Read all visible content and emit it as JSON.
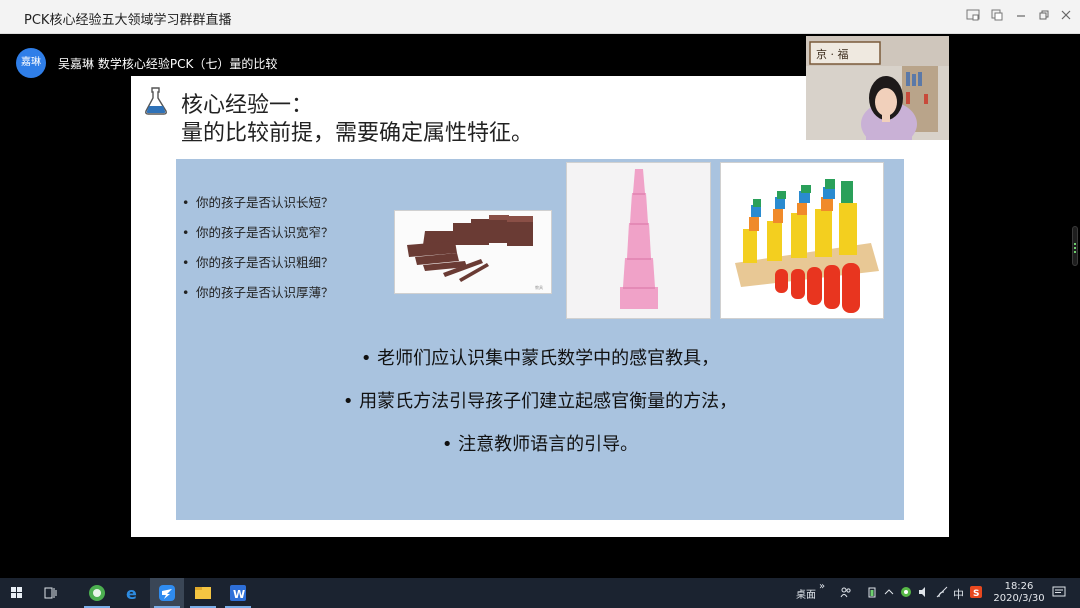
{
  "window": {
    "title": "PCK核心经验五大领域学习群群直播"
  },
  "presenter": {
    "avatar_text": "嘉琳",
    "name": "吴嘉琳",
    "topic": "数学核心经验PCK（七）量的比较"
  },
  "slide": {
    "heading_line1": "核心经验一：",
    "heading_line2": "量的比较前提，需要确定属性特征。",
    "questions": [
      "你的孩子是否认识长短？",
      "你的孩子是否认识宽窄？",
      "你的孩子是否认识粗细？",
      "你的孩子是否认识厚薄？"
    ],
    "points": [
      "• 老师们应认识集中蒙氏数学中的感官教具，",
      "• 用蒙氏方法引导孩子们建立起感官衡量的方法，",
      "• 注意教师语言的引导。"
    ]
  },
  "taskbar": {
    "desktop_label": "桌面",
    "ime_label": "中",
    "time": "18:26",
    "date": "2020/3/30"
  },
  "colors": {
    "panel": "#a9c3df",
    "taskbar": "#1b2330",
    "avatar": "#2f7ee8"
  }
}
